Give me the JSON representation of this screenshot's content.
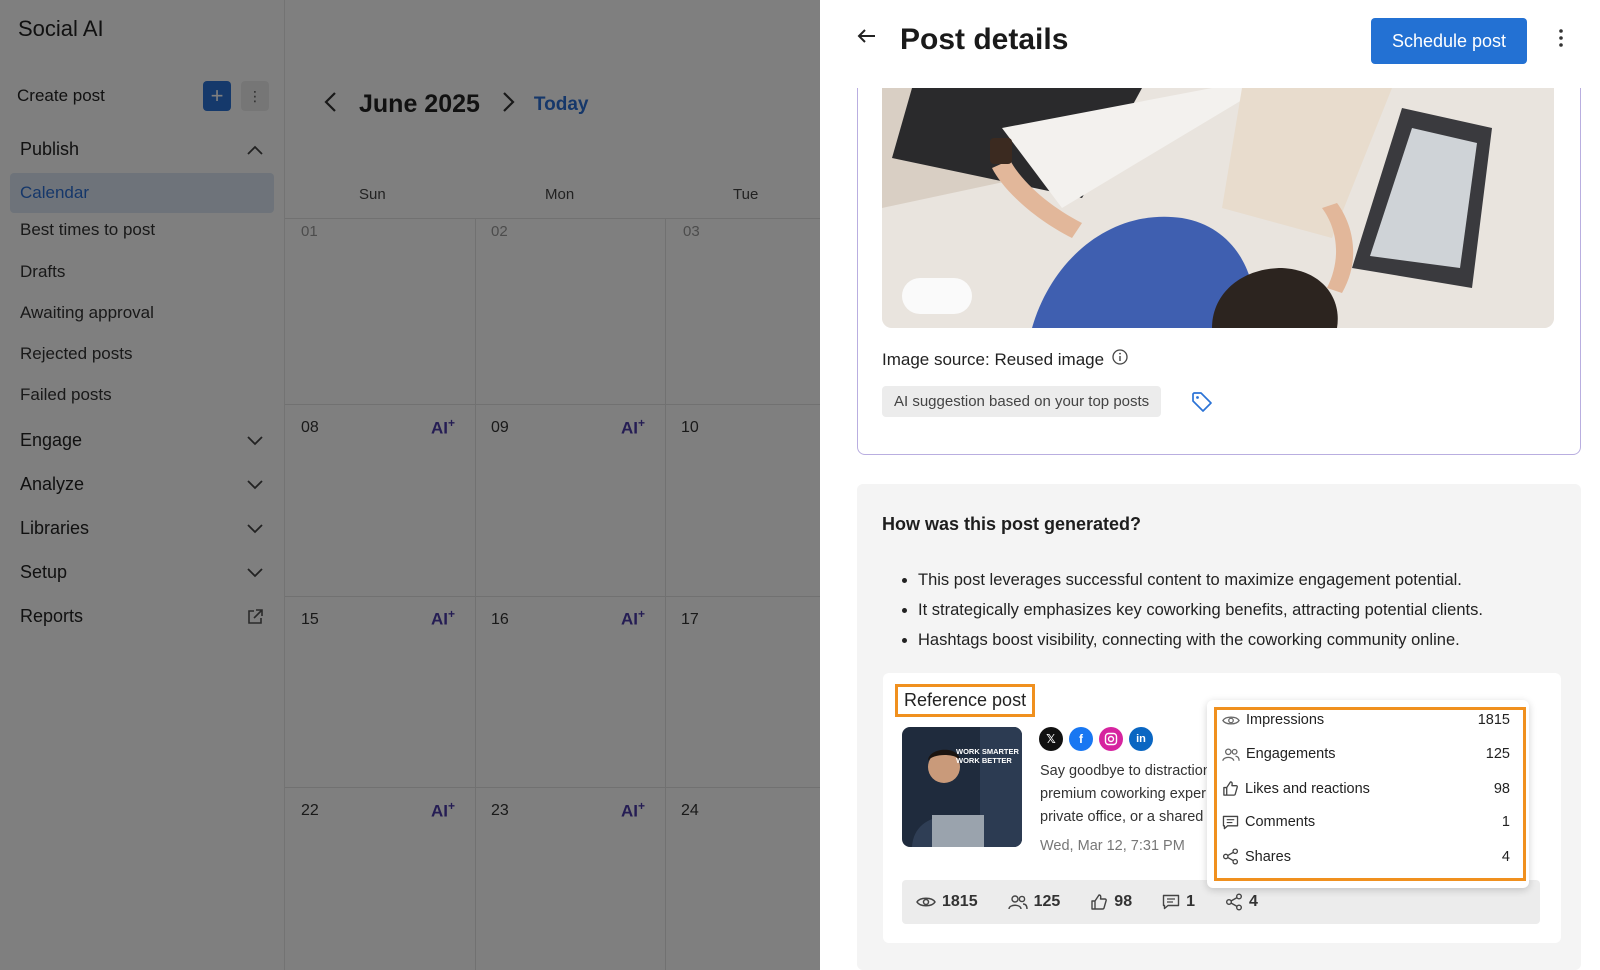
{
  "app": {
    "title": "Social AI"
  },
  "sidebar": {
    "create_label": "Create post",
    "sections": [
      {
        "label": "Publish",
        "expanded": true
      },
      {
        "label": "Engage",
        "expanded": false
      },
      {
        "label": "Analyze",
        "expanded": false
      },
      {
        "label": "Libraries",
        "expanded": false
      },
      {
        "label": "Setup",
        "expanded": false
      },
      {
        "label": "Reports"
      }
    ],
    "publish_items": [
      "Calendar",
      "Best times to post",
      "Drafts",
      "Awaiting approval",
      "Rejected posts",
      "Failed posts"
    ],
    "active_item": "Calendar"
  },
  "calendar": {
    "month": "June 2025",
    "today_label": "Today",
    "days": [
      "Sun",
      "Mon",
      "Tue"
    ],
    "weeks": [
      [
        "01",
        "02",
        "03"
      ],
      [
        "08",
        "09",
        "10"
      ],
      [
        "15",
        "16",
        "17"
      ],
      [
        "22",
        "23",
        "24"
      ]
    ],
    "ai_label": "AI"
  },
  "panel": {
    "title": "Post details",
    "schedule_label": "Schedule post",
    "image_source": "Image source: Reused image",
    "ai_chip": "AI suggestion based on your top posts",
    "generated_title": "How was this post generated?",
    "bullets": [
      "This post leverages successful content to maximize engagement potential.",
      "It strategically emphasizes key coworking benefits, attracting potential clients.",
      "Hashtags boost visibility, connecting with the coworking community online."
    ],
    "reference": {
      "label": "Reference post",
      "thumb_text": [
        "WORK SMARTER",
        "WORK BETTER"
      ],
      "text_lines": [
        "Say goodbye to distraction",
        "premium coworking exper",
        "private office, or a shared"
      ],
      "date": "Wed, Mar 12, 7:31 PM",
      "stats": {
        "impressions": "1815",
        "engagements": "125",
        "likes": "98",
        "comments": "1",
        "shares": "4"
      }
    },
    "metrics": [
      {
        "label": "Impressions",
        "value": "1815",
        "icon": "eye-icon"
      },
      {
        "label": "Engagements",
        "value": "125",
        "icon": "users-icon"
      },
      {
        "label": "Likes and reactions",
        "value": "98",
        "icon": "thumbs-up-icon"
      },
      {
        "label": "Comments",
        "value": "1",
        "icon": "comment-icon"
      },
      {
        "label": "Shares",
        "value": "4",
        "icon": "share-icon"
      }
    ]
  },
  "colors": {
    "accent": "#2371d3",
    "highlight": "#f0901e",
    "ai": "#4b3aa8"
  }
}
